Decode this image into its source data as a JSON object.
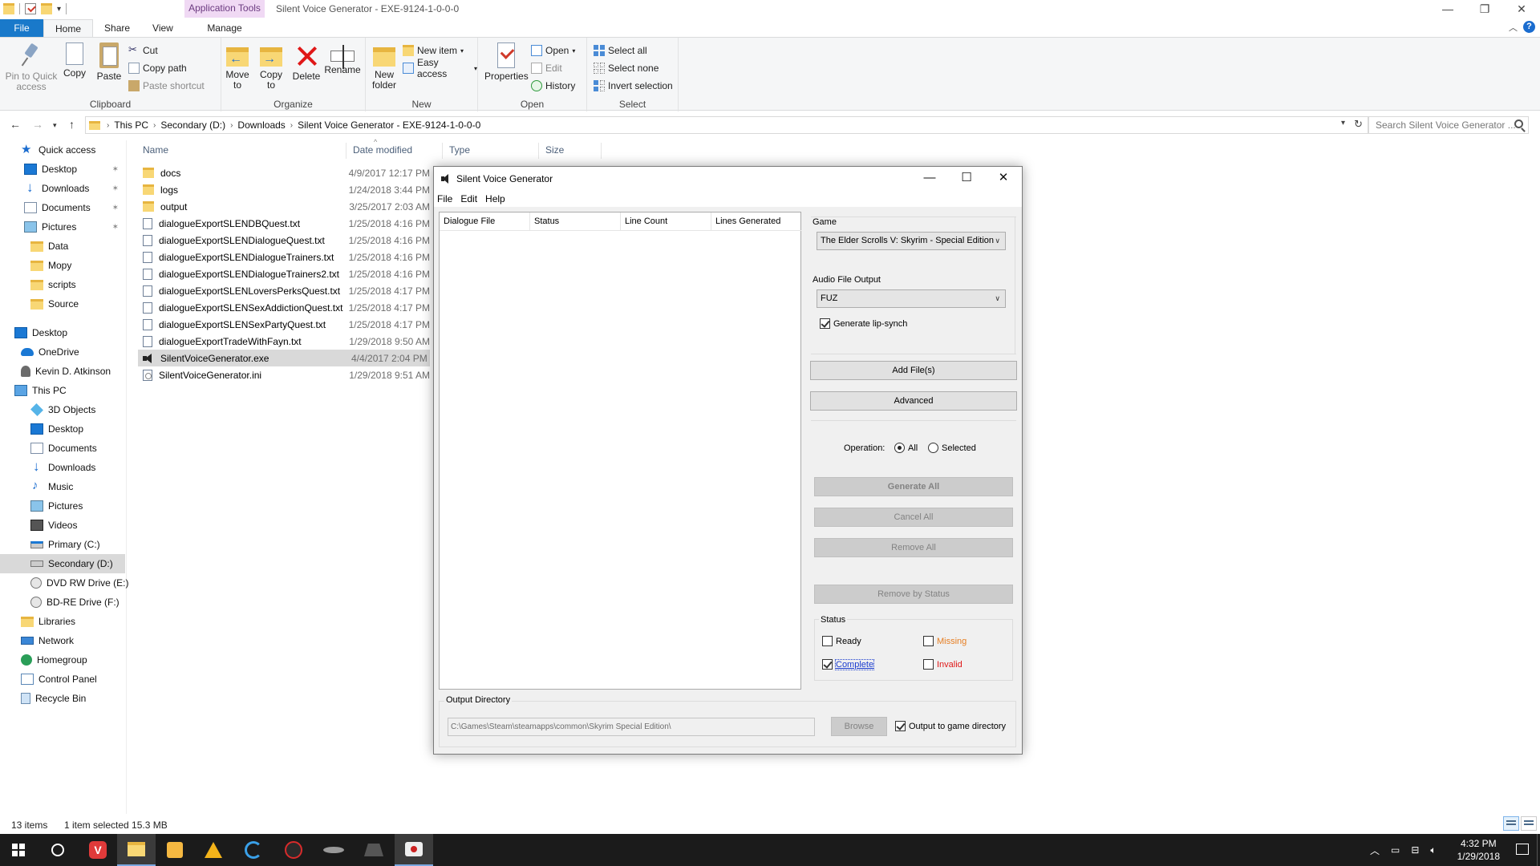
{
  "explorer": {
    "window_title": "Silent Voice Generator - EXE-9124-1-0-0-0",
    "context_tab_header": "Application Tools",
    "tabs": [
      "File",
      "Home",
      "Share",
      "View"
    ],
    "manage_tab": "Manage",
    "ribbon": {
      "clipboard": {
        "label": "Clipboard",
        "pin": "Pin to Quick access",
        "copy": "Copy",
        "paste": "Paste",
        "cut": "Cut",
        "copy_path": "Copy path",
        "paste_shortcut": "Paste shortcut"
      },
      "organize": {
        "label": "Organize",
        "move_to": "Move to",
        "copy_to": "Copy to",
        "delete": "Delete",
        "rename": "Rename"
      },
      "new": {
        "label": "New",
        "new_folder": "New folder",
        "new_item": "New item",
        "easy_access": "Easy access"
      },
      "open": {
        "label": "Open",
        "properties": "Properties",
        "open": "Open",
        "edit": "Edit",
        "history": "History"
      },
      "select": {
        "label": "Select",
        "select_all": "Select all",
        "select_none": "Select none",
        "invert": "Invert selection"
      }
    },
    "address": {
      "crumbs": [
        "This PC",
        "Secondary (D:)",
        "Downloads",
        "Silent Voice Generator - EXE-9124-1-0-0-0"
      ],
      "search_placeholder": "Search Silent Voice Generator ..."
    },
    "nav": [
      {
        "label": "Quick access",
        "icon": "star-icon"
      },
      {
        "label": "Desktop",
        "icon": "desktop-icon",
        "pinned": true
      },
      {
        "label": "Downloads",
        "icon": "download-icon",
        "pinned": true
      },
      {
        "label": "Documents",
        "icon": "documents-icon",
        "pinned": true
      },
      {
        "label": "Pictures",
        "icon": "pictures-icon",
        "pinned": true
      },
      {
        "label": "Data",
        "icon": "folder-icon"
      },
      {
        "label": "Mopy",
        "icon": "folder-icon"
      },
      {
        "label": "scripts",
        "icon": "folder-icon"
      },
      {
        "label": "Source",
        "icon": "folder-icon"
      },
      {
        "label": "Desktop",
        "icon": "desktop-icon"
      },
      {
        "label": "OneDrive",
        "icon": "cloud-icon"
      },
      {
        "label": "Kevin D. Atkinson",
        "icon": "user-icon"
      },
      {
        "label": "This PC",
        "icon": "computer-icon"
      },
      {
        "label": "3D Objects",
        "icon": "3d-objects-icon"
      },
      {
        "label": "Desktop",
        "icon": "desktop-icon"
      },
      {
        "label": "Documents",
        "icon": "documents-icon"
      },
      {
        "label": "Downloads",
        "icon": "download-icon"
      },
      {
        "label": "Music",
        "icon": "music-icon"
      },
      {
        "label": "Pictures",
        "icon": "pictures-icon"
      },
      {
        "label": "Videos",
        "icon": "videos-icon"
      },
      {
        "label": "Primary (C:)",
        "icon": "drive-c-icon"
      },
      {
        "label": "Secondary (D:)",
        "icon": "drive-icon",
        "selected": true
      },
      {
        "label": "DVD RW Drive (E:)",
        "icon": "disc-icon"
      },
      {
        "label": "BD-RE Drive (F:)",
        "icon": "disc-icon"
      },
      {
        "label": "Libraries",
        "icon": "libraries-icon"
      },
      {
        "label": "Network",
        "icon": "network-icon"
      },
      {
        "label": "Homegroup",
        "icon": "homegroup-icon"
      },
      {
        "label": "Control Panel",
        "icon": "control-panel-icon"
      },
      {
        "label": "Recycle Bin",
        "icon": "recycle-bin-icon"
      }
    ],
    "columns": [
      "Name",
      "Date modified",
      "Type",
      "Size"
    ],
    "files": [
      {
        "name": "docs",
        "date": "4/9/2017 12:17 PM",
        "icon": "folder-icon"
      },
      {
        "name": "logs",
        "date": "1/24/2018 3:44 PM",
        "icon": "folder-icon"
      },
      {
        "name": "output",
        "date": "3/25/2017 2:03 AM",
        "icon": "folder-icon"
      },
      {
        "name": "dialogueExportSLENDBQuest.txt",
        "date": "1/25/2018 4:16 PM",
        "icon": "text-file-icon"
      },
      {
        "name": "dialogueExportSLENDialogueQuest.txt",
        "date": "1/25/2018 4:16 PM",
        "icon": "text-file-icon"
      },
      {
        "name": "dialogueExportSLENDialogueTrainers.txt",
        "date": "1/25/2018 4:16 PM",
        "icon": "text-file-icon"
      },
      {
        "name": "dialogueExportSLENDialogueTrainers2.txt",
        "date": "1/25/2018 4:16 PM",
        "icon": "text-file-icon"
      },
      {
        "name": "dialogueExportSLENLoversPerksQuest.txt",
        "date": "1/25/2018 4:17 PM",
        "icon": "text-file-icon"
      },
      {
        "name": "dialogueExportSLENSexAddictionQuest.txt",
        "date": "1/25/2018 4:17 PM",
        "icon": "text-file-icon"
      },
      {
        "name": "dialogueExportSLENSexPartyQuest.txt",
        "date": "1/25/2018 4:17 PM",
        "icon": "text-file-icon"
      },
      {
        "name": "dialogueExportTradeWithFayn.txt",
        "date": "1/29/2018 9:50 AM",
        "icon": "text-file-icon"
      },
      {
        "name": "SilentVoiceGenerator.exe",
        "date": "4/4/2017 2:04 PM",
        "icon": "speaker-icon",
        "selected": true
      },
      {
        "name": "SilentVoiceGenerator.ini",
        "date": "1/29/2018 9:51 AM",
        "icon": "settings-file-icon"
      }
    ],
    "status": {
      "items": "13 items",
      "selected": "1 item selected  15.3 MB"
    }
  },
  "dialog": {
    "title": "Silent Voice Generator",
    "menu": [
      "File",
      "Edit",
      "Help"
    ],
    "grid_columns": [
      "Dialogue File",
      "Status",
      "Line Count",
      "Lines Generated"
    ],
    "game_label": "Game",
    "game_value": "The Elder Scrolls V: Skyrim - Special Edition",
    "audio_label": "Audio File Output",
    "audio_value": "FUZ",
    "lipsync_label": "Generate lip-synch",
    "add_files": "Add File(s)",
    "advanced": "Advanced",
    "operation_label": "Operation:",
    "op_all": "All",
    "op_selected": "Selected",
    "generate_all": "Generate All",
    "cancel_all": "Cancel All",
    "remove_all": "Remove All",
    "remove_by_status": "Remove by Status",
    "status_label": "Status",
    "status_ready": "Ready",
    "status_missing": "Missing",
    "status_complete": "Complete",
    "status_invalid": "Invalid",
    "output_dir_label": "Output Directory",
    "output_dir_value": "C:\\Games\\Steam\\steamapps\\common\\Skyrim Special Edition\\",
    "browse": "Browse",
    "output_to_game": "Output to game directory",
    "colors": {
      "missing": "#e67e22",
      "invalid": "#e01818",
      "complete_focus": "#1a3ccf"
    }
  },
  "taskbar": {
    "time": "4:32 PM",
    "date": "1/29/2018",
    "apps": [
      "start-icon",
      "cortana-icon",
      "vivaldi-icon",
      "file-explorer-icon",
      "office-icon",
      "app-triangle-icon",
      "browser-icon",
      "app-red-icon",
      "app-ship-icon",
      "app-gear-icon",
      "silent-voice-generator-icon"
    ]
  }
}
